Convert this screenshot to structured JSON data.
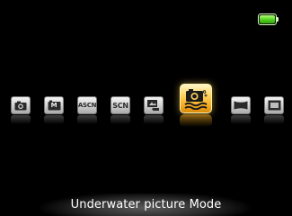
{
  "status": {
    "battery_icon": "battery-full-icon",
    "battery_level": 1.0,
    "battery_color": "#4fd11e"
  },
  "modes": [
    {
      "id": "auto",
      "icon": "camera-icon",
      "label": ""
    },
    {
      "id": "manual",
      "icon": "manual-mode-icon",
      "label": "M"
    },
    {
      "id": "asc",
      "icon": "auto-scene-icon",
      "label": "ASCN"
    },
    {
      "id": "scene",
      "icon": "scene-icon",
      "label": "SCN"
    },
    {
      "id": "blur-reduction",
      "icon": "image-stabilizer-icon",
      "label": ""
    },
    {
      "id": "underwater",
      "icon": "underwater-camera-icon",
      "label": "",
      "selected": true
    },
    {
      "id": "panorama",
      "icon": "panorama-icon",
      "label": ""
    },
    {
      "id": "frame",
      "icon": "frame-icon",
      "label": ""
    }
  ],
  "caption": {
    "text": "Underwater picture Mode"
  },
  "colors": {
    "selected_accent": "#ffd25a",
    "background": "#000000"
  }
}
